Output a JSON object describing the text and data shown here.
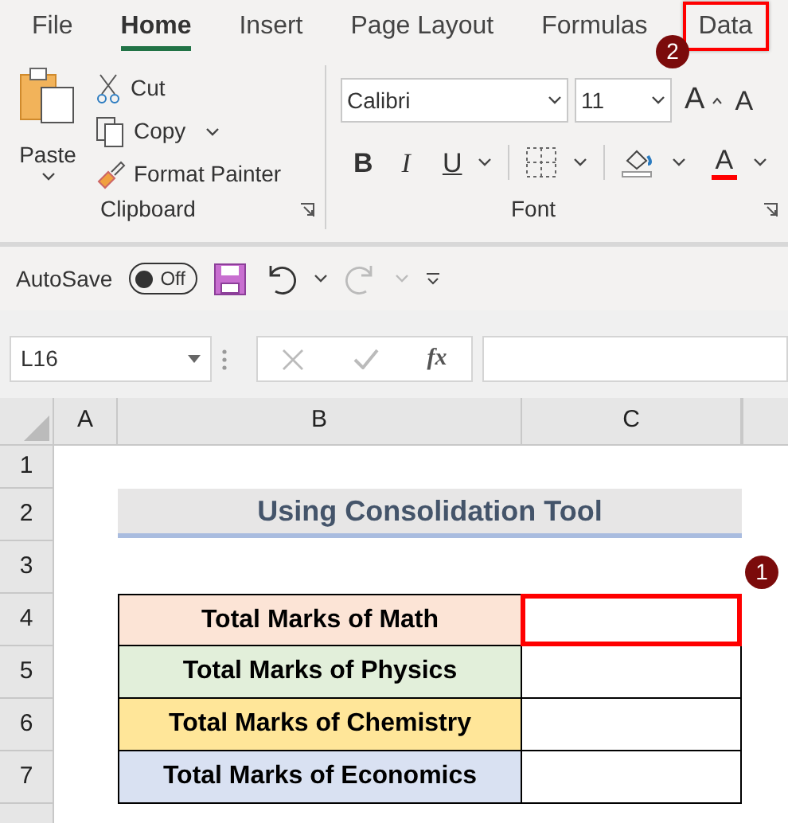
{
  "menu_tabs": [
    {
      "label": "File",
      "selected": false,
      "highlighted": false
    },
    {
      "label": "Home",
      "selected": true,
      "highlighted": false
    },
    {
      "label": "Insert",
      "selected": false,
      "highlighted": false
    },
    {
      "label": "Page Layout",
      "selected": false,
      "highlighted": false
    },
    {
      "label": "Formulas",
      "selected": false,
      "highlighted": false
    },
    {
      "label": "Data",
      "selected": false,
      "highlighted": true
    }
  ],
  "ribbon": {
    "clipboard": {
      "paste": "Paste",
      "cut": "Cut",
      "copy": "Copy",
      "format_painter": "Format Painter",
      "label": "Clipboard"
    },
    "font": {
      "font_name": "Calibri",
      "font_size": "11",
      "grow": "A",
      "shrink": "A",
      "bold": "B",
      "italic": "I",
      "underline": "U",
      "font_color": "A",
      "label": "Font"
    }
  },
  "quick_access": {
    "autosave_label": "AutoSave",
    "autosave_state": "Off",
    "autosave_on": false
  },
  "formula_bar": {
    "name_box": "L16",
    "fx": "fx"
  },
  "columns": [
    "A",
    "B",
    "C"
  ],
  "row_numbers": [
    "1",
    "2",
    "3",
    "4",
    "5",
    "6",
    "7"
  ],
  "sheet": {
    "title": "Using Consolidation Tool",
    "rows": [
      {
        "label": "Total Marks of Math",
        "color": "#fce4d6",
        "highlighted": true
      },
      {
        "label": "Total Marks of Physics",
        "color": "#e2efda",
        "highlighted": false
      },
      {
        "label": "Total Marks of Chemistry",
        "color": "#ffe699",
        "highlighted": false
      },
      {
        "label": "Total Marks of Economics",
        "color": "#d9e1f2",
        "highlighted": false
      }
    ]
  },
  "cell_callout": {
    "number": "1"
  },
  "tab_callout": {
    "number": "2"
  }
}
